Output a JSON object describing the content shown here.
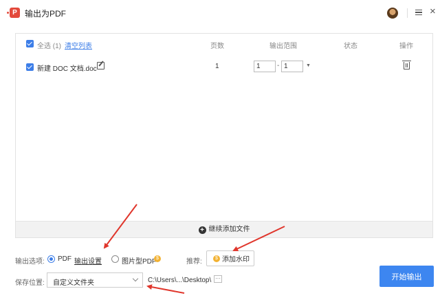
{
  "window": {
    "logo_letter": "P",
    "title": "输出为PDF"
  },
  "table": {
    "select_all_label": "全选 (1)",
    "clear_list": "清空列表",
    "headers": {
      "pages": "页数",
      "range": "输出范围",
      "status": "状态",
      "actions": "操作"
    },
    "rows": [
      {
        "filename": "新建 DOC 文档.doc",
        "pages": "1",
        "range_from": "1",
        "range_to": "1",
        "range_dash": "-",
        "status": ""
      }
    ],
    "add_files": "继续添加文件"
  },
  "options": {
    "label": "输出选项:",
    "pdf_label": "PDF",
    "settings_link": "输出设置",
    "image_pdf_label": "图片型PDF",
    "coin_symbol": "$",
    "selected": "PDF",
    "recommend_label": "推荐:",
    "watermark_button": "添加水印"
  },
  "save": {
    "label": "保存位置:",
    "selected_option": "自定义文件夹",
    "path": "C:\\Users\\...\\Desktop\\",
    "more_button": "···"
  },
  "start_button": "开始输出",
  "icons": {
    "close": "×",
    "plus": "+",
    "range_arrow": "▼"
  },
  "colors": {
    "accent": "#3d86f0",
    "logo": "#e3493b",
    "annotation_arrows": "#e0362c",
    "coin": "#f2b233"
  }
}
